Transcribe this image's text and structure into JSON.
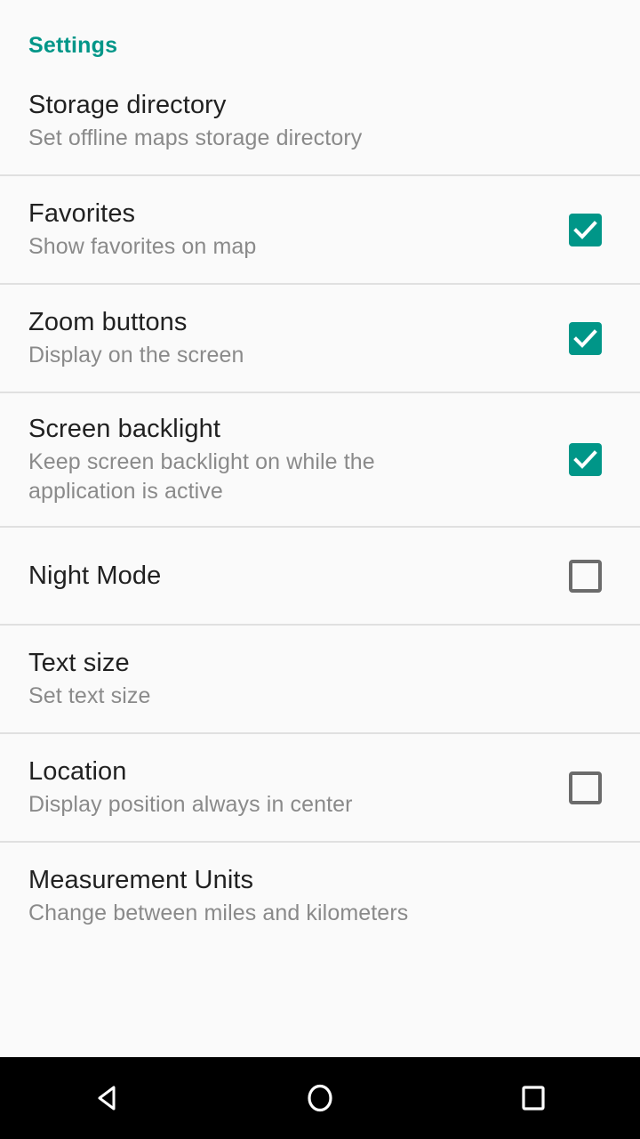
{
  "screen": {
    "section_header": "Settings",
    "accent_color": "#009688",
    "background_color": "#fafafa",
    "title_color": "#212121",
    "summary_color": "#8a8a8a",
    "divider_color": "#e0e0e0",
    "checkbox_unchecked_color": "#6b6b6b"
  },
  "preferences": [
    {
      "title": "Storage directory",
      "summary": "Set offline maps storage directory",
      "widget": "none",
      "checked": null
    },
    {
      "title": "Favorites",
      "summary": "Show favorites on map",
      "widget": "checkbox",
      "checked": true
    },
    {
      "title": "Zoom buttons",
      "summary": "Display on the screen",
      "widget": "checkbox",
      "checked": true
    },
    {
      "title": "Screen backlight",
      "summary": "Keep screen backlight on while the application is active",
      "widget": "checkbox",
      "checked": true
    },
    {
      "title": "Night Mode",
      "summary": "",
      "widget": "checkbox",
      "checked": false
    },
    {
      "title": "Text size",
      "summary": "Set text size",
      "widget": "none",
      "checked": null
    },
    {
      "title": "Location",
      "summary": "Display position always in center",
      "widget": "checkbox",
      "checked": false
    },
    {
      "title": "Measurement Units",
      "summary": "Change between miles and kilometers",
      "widget": "none",
      "checked": null
    }
  ],
  "navbar": {
    "background_color": "#000000",
    "buttons": [
      {
        "name": "back",
        "icon": "triangle-left-icon"
      },
      {
        "name": "home",
        "icon": "circle-icon"
      },
      {
        "name": "recents",
        "icon": "square-icon"
      }
    ]
  }
}
